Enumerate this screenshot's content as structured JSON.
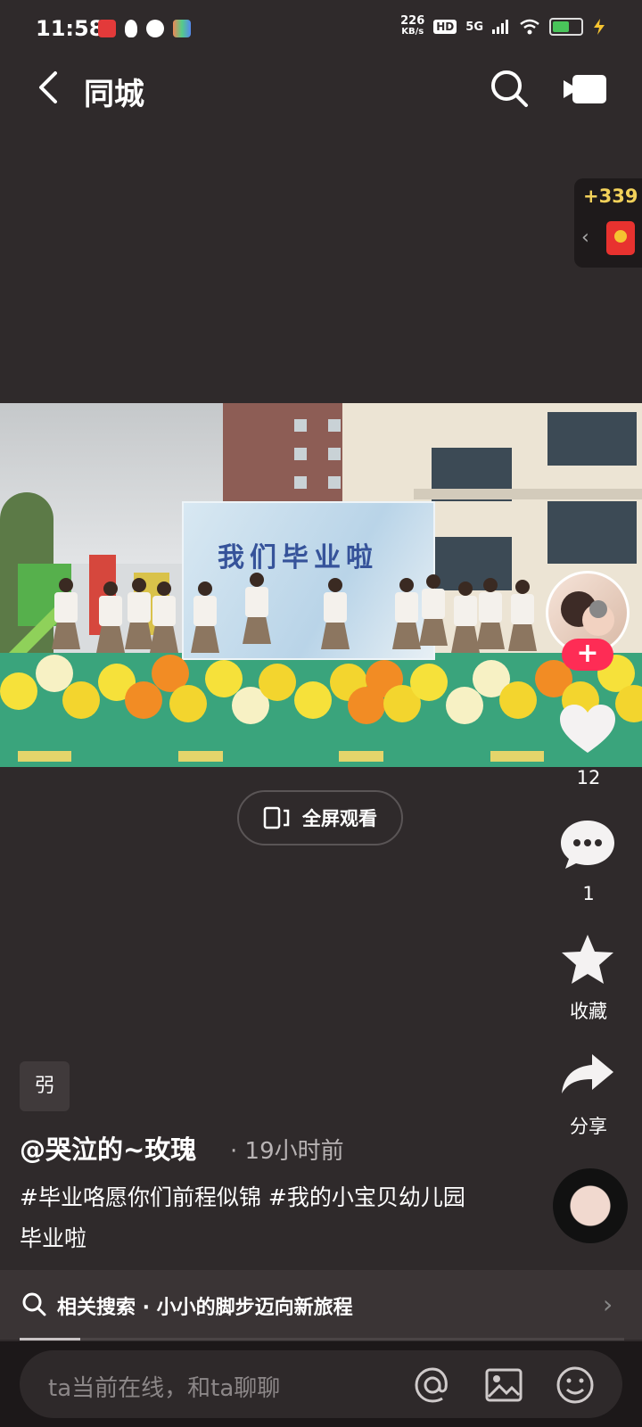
{
  "status_bar": {
    "time": "11:58",
    "net_speed_value": "226",
    "net_speed_unit": "KB/s",
    "hd": "HD",
    "network": "5G"
  },
  "header": {
    "title": "同城"
  },
  "reward": {
    "count": "+339",
    "chevron": "‹"
  },
  "video": {
    "banner_text": "我们毕业啦"
  },
  "fullscreen": {
    "label": "全屏观看"
  },
  "actions": {
    "likes": "12",
    "comments": "1",
    "favorite_label": "收藏",
    "share_label": "分享"
  },
  "post": {
    "tag_chip": "弜",
    "author": "@哭泣的~玫瑰",
    "time_ago": "· 19小时前",
    "caption": "#毕业咯愿你们前程似锦 #我的小宝贝幼儿园毕业啦"
  },
  "related_search": {
    "label": "相关搜索 · 小小的脚步迈向新旅程",
    "arrow": "›"
  },
  "comment_bar": {
    "placeholder": "ta当前在线，和ta聊聊"
  },
  "colors": {
    "background": "#2f2a2b",
    "follow_button": "#fe2c55",
    "reward_text": "#f2d15a"
  },
  "icons": [
    "back-arrow-icon",
    "search-icon",
    "camera-icon",
    "red-envelope-icon",
    "heart-icon",
    "comment-icon",
    "star-icon",
    "share-icon",
    "fullscreen-icon",
    "at-icon",
    "image-icon",
    "emoji-icon"
  ]
}
